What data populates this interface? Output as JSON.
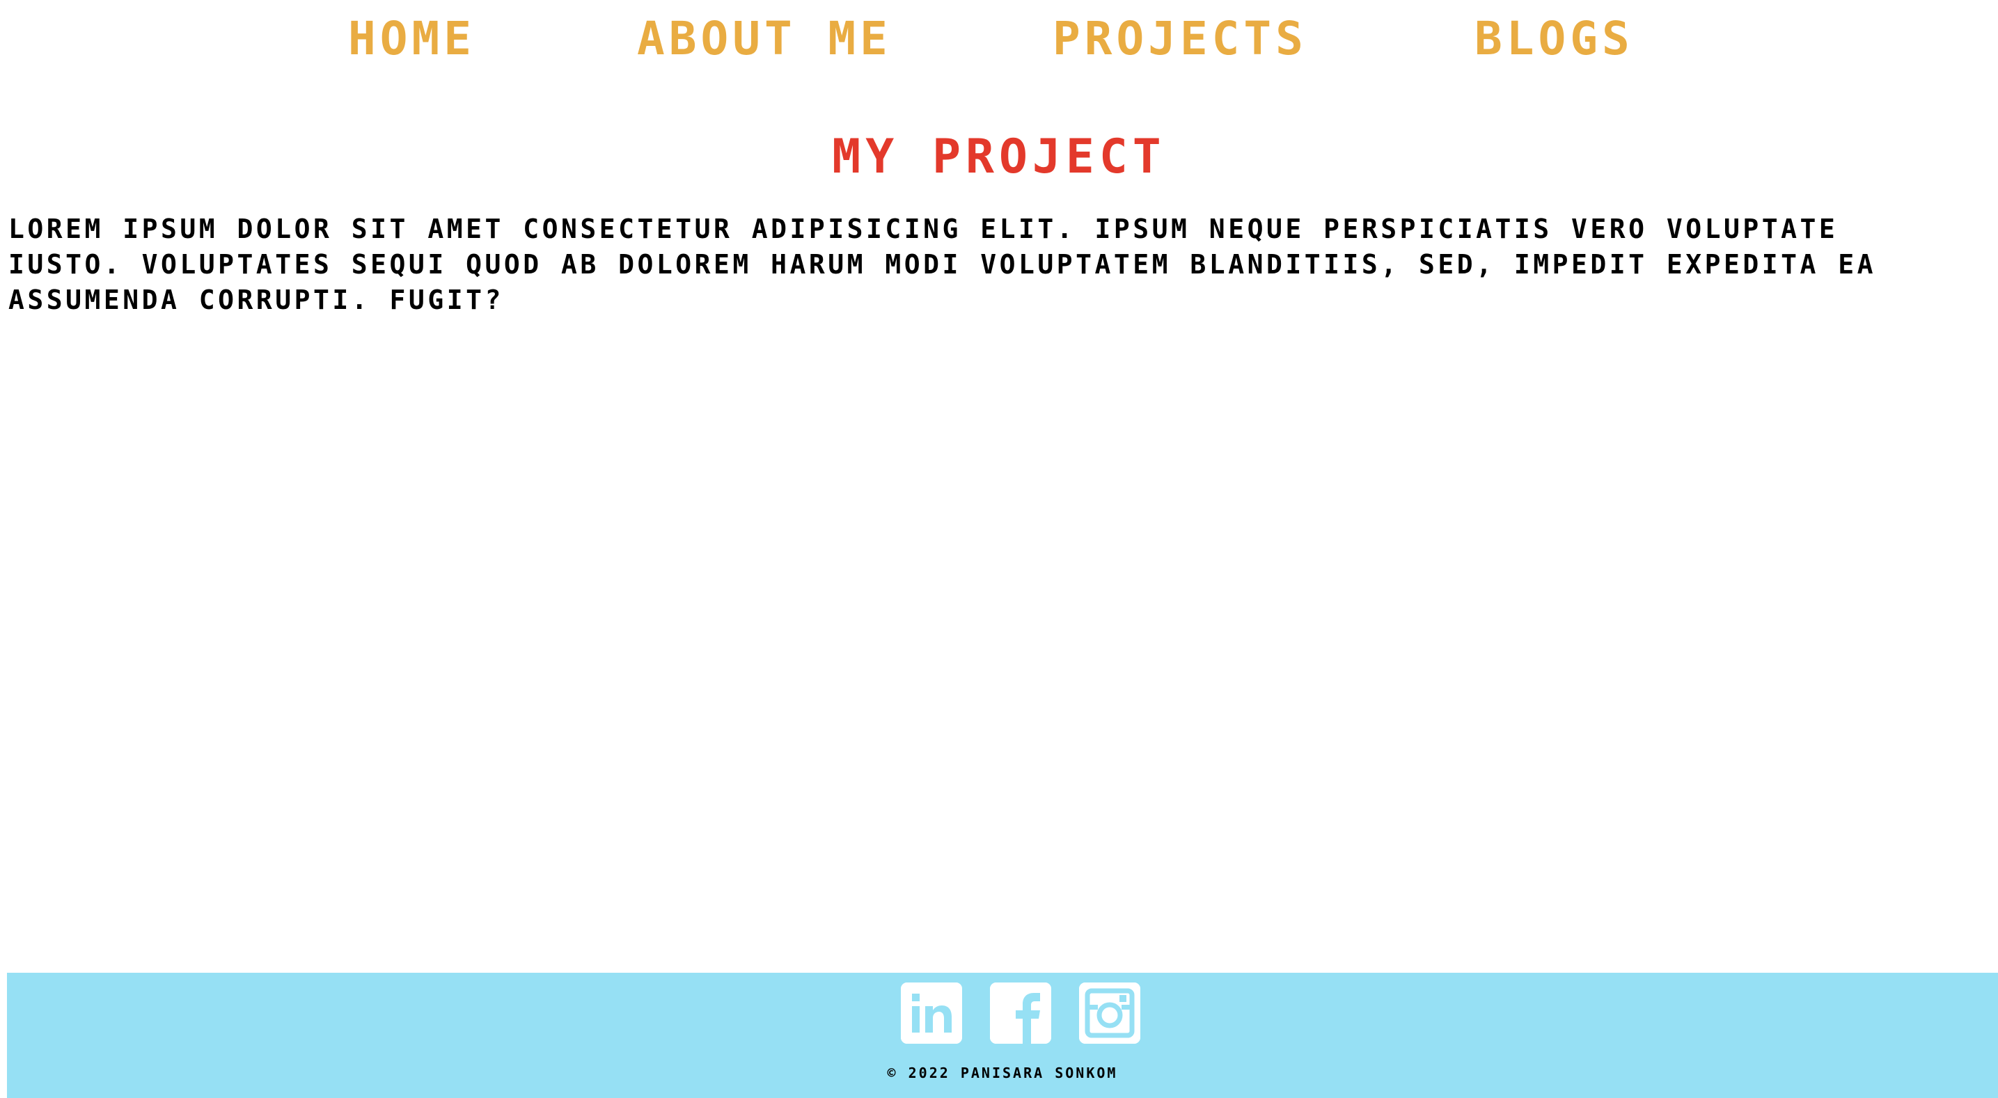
{
  "nav": {
    "items": [
      {
        "label": "Home"
      },
      {
        "label": "About me"
      },
      {
        "label": "Projects"
      },
      {
        "label": "Blogs"
      }
    ]
  },
  "main": {
    "title": "My project",
    "paragraph": "Lorem ipsum dolor sit amet consectetur adipisicing elit. Ipsum neque perspiciatis vero voluptate iusto. Voluptates sequi quod ab dolorem harum modi voluptatem blanditiis, sed, impedit expedita ea assumenda corrupti. Fugit?"
  },
  "footer": {
    "social_icons": [
      "linkedin-icon",
      "facebook-icon",
      "instagram-icon"
    ],
    "copyright": "© 2022 Panisara Sonkom"
  },
  "colors": {
    "nav_text": "#e9ac42",
    "title_text": "#e3392b",
    "body_text": "#000000",
    "footer_background": "#96e0f4",
    "icon_background": "#ffffff"
  }
}
